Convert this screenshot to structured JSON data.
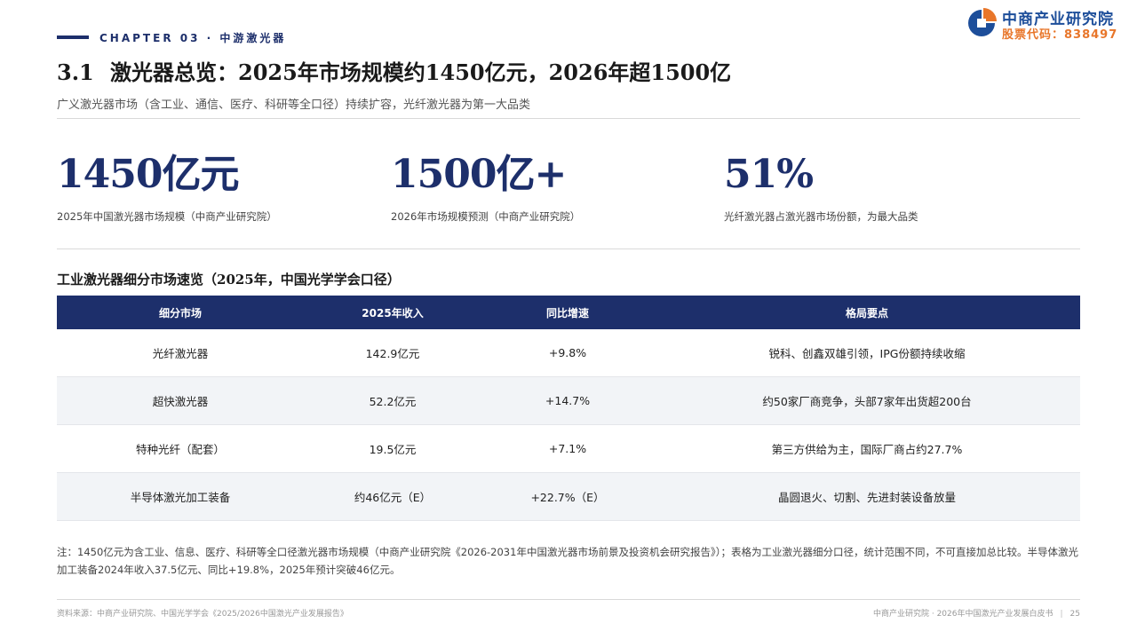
{
  "header": {
    "chapter": "CHAPTER 03 · 中游激光器",
    "logo_name": "中商产业研究院",
    "logo_code": "股票代码：838497",
    "colors": {
      "navy": "#1d2f6b",
      "logo_blue": "#1d4e9a",
      "logo_orange": "#e8762a"
    }
  },
  "title": {
    "number": "3.1",
    "text": "激光器总览：2025年市场规模约1450亿元，2026年超1500亿"
  },
  "subtitle": "广义激光器市场（含工业、通信、医疗、科研等全口径）持续扩容，光纤激光器为第一大品类",
  "kpis": [
    {
      "value": "1450亿元",
      "label": "2025年中国激光器市场规模（中商产业研究院）"
    },
    {
      "value": "1500亿+",
      "label": "2026年市场规模预测（中商产业研究院）"
    },
    {
      "value": "51%",
      "label": "光纤激光器占激光器市场份额，为最大品类"
    }
  ],
  "table": {
    "title": "工业激光器细分市场速览（2025年，中国光学学会口径）",
    "headers": [
      "细分市场",
      "2025年收入",
      "同比增速",
      "格局要点"
    ],
    "rows": [
      [
        "光纤激光器",
        "142.9亿元",
        "+9.8%",
        "锐科、创鑫双雄引领，IPG份额持续收缩"
      ],
      [
        "超快激光器",
        "52.2亿元",
        "+14.7%",
        "约50家厂商竞争，头部7家年出货超200台"
      ],
      [
        "特种光纤（配套）",
        "19.5亿元",
        "+7.1%",
        "第三方供给为主，国际厂商占约27.7%"
      ],
      [
        "半导体激光加工装备",
        "约46亿元（E）",
        "+22.7%（E）",
        "晶圆退火、切割、先进封装设备放量"
      ]
    ]
  },
  "note": "注：1450亿元为含工业、信息、医疗、科研等全口径激光器市场规模（中商产业研究院《2026-2031年中国激光器市场前景及投资机会研究报告》）；表格为工业激光器细分口径，统计范围不同，不可直接加总比较。半导体激光加工装备2024年收入37.5亿元、同比+19.8%，2025年预计突破46亿元。",
  "footer": {
    "source": "资料来源：中商产业研究院、中国光学学会《2025/2026中国激光产业发展报告》",
    "doc": "中商产业研究院 · 2026年中国激光产业发展白皮书",
    "page": "25"
  }
}
